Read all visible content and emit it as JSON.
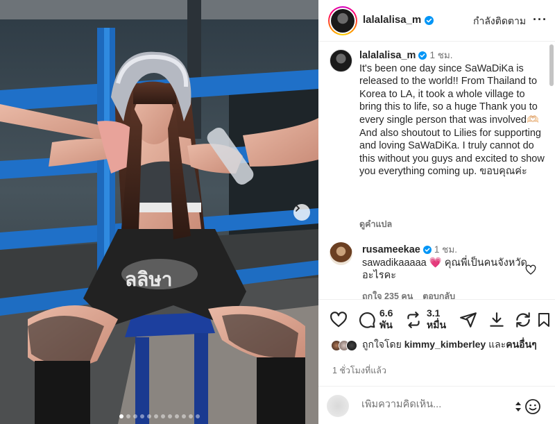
{
  "post": {
    "author": "lalalalisa_m",
    "verified": true,
    "follow_label": "กำลังติดตาม",
    "more_label": "···"
  },
  "caption": {
    "author": "lalalalisa_m",
    "time": "1 ชม.",
    "text": "It's been one day since SaWaDiKa is released to the world!! From Thailand to Korea to LA, it took a whole village to bring this to life, so a huge Thank you to every single person that was involved🫶🏻 And also shoutout to Lilies for supporting and loving SaWaDiKa. I truly cannot do this without you guys and excited to show you everything coming up. ขอบคุณค่ะ",
    "translate_label": "ดูคำแปล"
  },
  "comment": {
    "author": "rusameekae",
    "verified": true,
    "time": "1 ชม.",
    "text": "sawadikaaaaa 💗 คุณพี่เป็นคนจังหวัดอะไรคะ",
    "likes_label": "ถูกใจ 235 คน",
    "reply_label": "ตอบกลับ"
  },
  "stats": {
    "comments_count": "6.6",
    "comments_unit": "พัน",
    "reposts_count": "3.1",
    "reposts_unit": "หมื่น"
  },
  "likes": {
    "prefix": "ถูกใจโดย",
    "user": "kimmy_kimberley",
    "joiner": "และ",
    "others": "คนอื่นๆ"
  },
  "time_ago": "1 ชั่วโมงที่แล้ว",
  "add_comment": {
    "placeholder": "เพิ่มความคิดเห็น..."
  },
  "carousel": {
    "slides_total": 12,
    "active_index": 0
  },
  "colors": {
    "verified": "#0095f6",
    "text_primary": "#262626",
    "text_secondary": "#737373",
    "ring_gradient": [
      "#d300c5",
      "#ff0069",
      "#ff7a00",
      "#ffd600"
    ]
  }
}
